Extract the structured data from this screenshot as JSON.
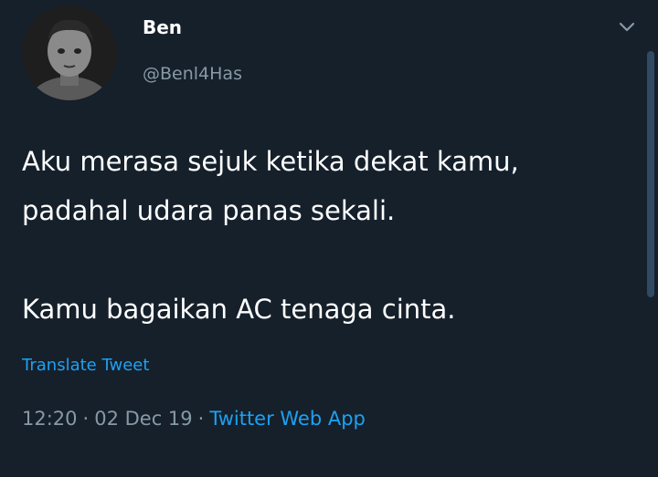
{
  "tweet": {
    "display_name": "Ben",
    "handle": "@Benl4Has",
    "text_line_1": "Aku merasa sejuk ketika dekat kamu,",
    "text_line_2": "padahal udara panas sekali.",
    "text_line_3": "Kamu bagaikan AC tenaga cinta.",
    "translate_label": "Translate Tweet",
    "time": "12:20",
    "date": "02 Dec 19",
    "separator": "·",
    "source": "Twitter Web App"
  },
  "colors": {
    "background": "#15202b",
    "text": "#ffffff",
    "secondary_text": "#8899a6",
    "accent": "#1da1f2"
  },
  "icons": {
    "menu": "chevron-down-icon",
    "avatar": "avatar-photo"
  }
}
